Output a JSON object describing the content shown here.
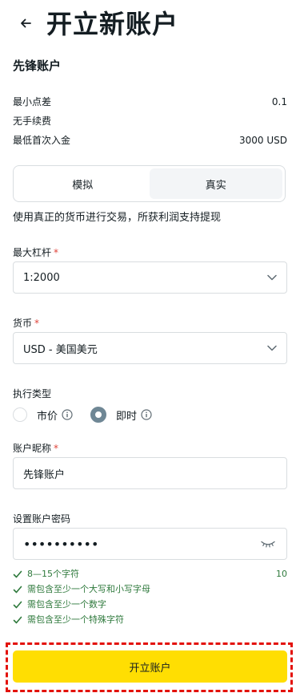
{
  "header": {
    "title": "开立新账户"
  },
  "account_type": "先锋账户",
  "specs": [
    {
      "label": "最小点差",
      "value": "0.1"
    },
    {
      "label": "无手续费",
      "value": ""
    },
    {
      "label": "最低首次入金",
      "value": "3000 USD"
    }
  ],
  "mode_tabs": [
    {
      "label": "模拟",
      "active": false
    },
    {
      "label": "真实",
      "active": true
    }
  ],
  "description": "使用真正的货币进行交易，所获利润支持提现",
  "leverage": {
    "label": "最大杠杆",
    "required": "*",
    "value": "1:2000"
  },
  "currency": {
    "label": "货币",
    "required": "*",
    "value": "USD - 美国美元"
  },
  "execution": {
    "label": "执行类型",
    "options": [
      {
        "label": "市价",
        "checked": false
      },
      {
        "label": "即时",
        "checked": true
      }
    ]
  },
  "nickname": {
    "label": "账户昵称",
    "required": "*",
    "value": "先锋账户"
  },
  "password": {
    "label": "设置账户密码",
    "masked_value": "••••••••••",
    "rules": [
      {
        "text": "8—15个字符",
        "count": "10"
      },
      {
        "text": "需包含至少一个大写和小写字母",
        "count": ""
      },
      {
        "text": "需包含至少一个数字",
        "count": ""
      },
      {
        "text": "需包含至少一个特殊字符",
        "count": ""
      }
    ]
  },
  "submit": {
    "label": "开立账户"
  },
  "colors": {
    "accent": "#ffde02",
    "success": "#2f7a3d",
    "highlight": "#e3120b",
    "radio_checked": "#6f8795"
  }
}
